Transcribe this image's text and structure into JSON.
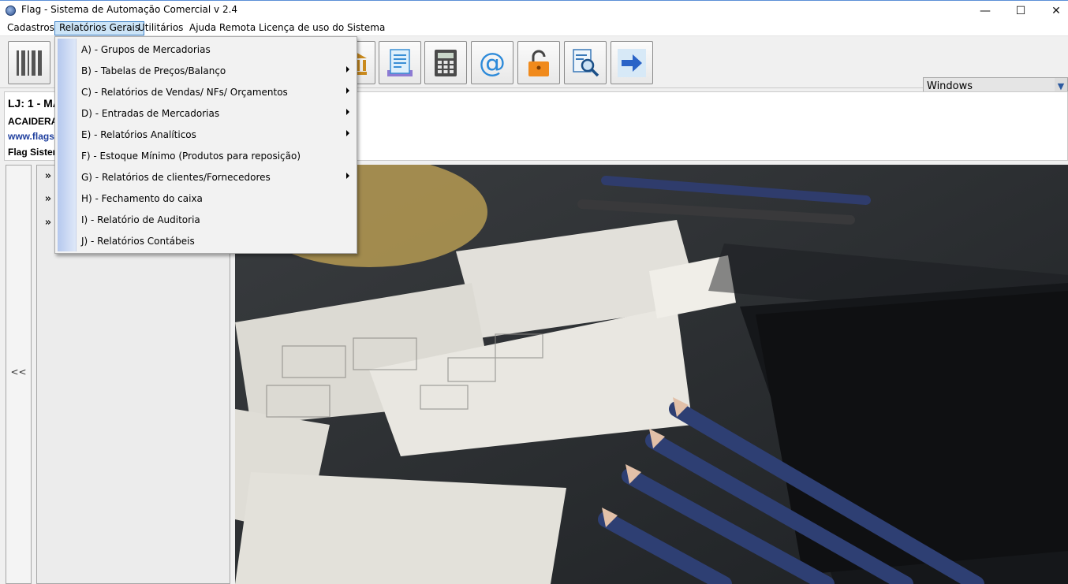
{
  "window": {
    "title": "Flag - Sistema de Automação Comercial v 2.4",
    "minimize": "—",
    "maximize": "☐",
    "close": "✕"
  },
  "menubar": {
    "items": [
      {
        "label": "Cadastros"
      },
      {
        "label": "Relatórios Gerais"
      },
      {
        "label": "Utilitários"
      },
      {
        "label": "Ajuda Remota"
      },
      {
        "label": "Licença de uso do Sistema"
      }
    ]
  },
  "dropdown": {
    "items": [
      {
        "label": "A) - Grupos de Mercadorias",
        "submenu": false
      },
      {
        "label": "B) - Tabelas de Preços/Balanço",
        "submenu": true
      },
      {
        "label": "C) - Relatórios de Vendas/ NFs/ Orçamentos",
        "submenu": true
      },
      {
        "label": "D) - Entradas de Mercadorias",
        "submenu": true
      },
      {
        "label": "E) - Relatórios Analíticos",
        "submenu": true
      },
      {
        "label": "F) - Estoque Mínimo (Produtos para reposição)",
        "submenu": false
      },
      {
        "label": "G) - Relatórios de clientes/Fornecedores",
        "submenu": true
      },
      {
        "label": "H) - Fechamento do caixa",
        "submenu": false
      },
      {
        "label": "I) - Relatório de Auditoria",
        "submenu": false
      },
      {
        "label": "J) - Relatórios Contábeis",
        "submenu": false
      }
    ]
  },
  "toolbar": {
    "buttons": [
      {
        "icon": "barcode-icon"
      },
      {
        "icon": "bank-icon"
      },
      {
        "icon": "receipt-icon"
      },
      {
        "icon": "calculator-icon"
      },
      {
        "icon": "email-icon"
      },
      {
        "icon": "unlock-icon"
      },
      {
        "icon": "search-document-icon"
      },
      {
        "icon": "exit-arrow-icon"
      }
    ],
    "theme_select": {
      "value": "Windows"
    }
  },
  "info": {
    "line1": "LJ: 1 - MA",
    "line2": "ACAIDERA",
    "line3": "www.flagsis",
    "line4": "Flag Sistem"
  },
  "sidebar": {
    "collapse_label": "<<",
    "expanders": [
      "»",
      "»",
      "»"
    ]
  },
  "colors": {
    "menu_highlight": "#cce4f7",
    "menu_highlight_border": "#3f82c8",
    "link_blue": "#1f3f9e",
    "exit_arrow": "#2a63c7",
    "lock_orange": "#f08a1c"
  }
}
